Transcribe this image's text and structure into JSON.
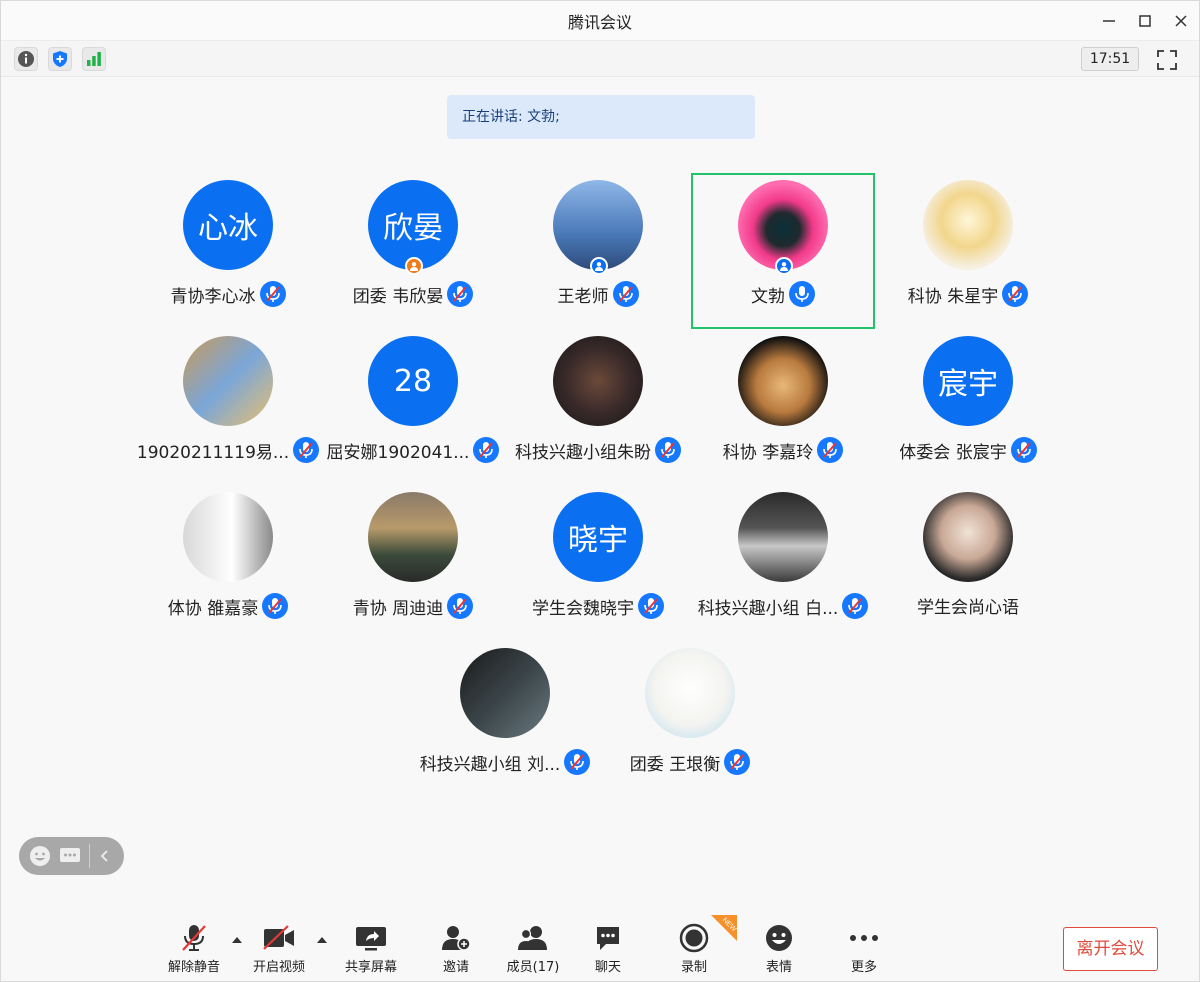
{
  "window": {
    "title": "腾讯会议"
  },
  "toolbar": {
    "time": "17:51"
  },
  "banner": {
    "text": "正在讲话: 文勃;"
  },
  "participants": [
    {
      "name": "青协李心冰",
      "avatar_text": "心冰",
      "avatar_type": "text",
      "badge": ""
    },
    {
      "name": "团委 韦欣晏",
      "avatar_text": "欣晏",
      "avatar_type": "text",
      "badge": "orange-person"
    },
    {
      "name": "王老师",
      "avatar_text": "",
      "avatar_type": "photo",
      "badge": "blue-person"
    },
    {
      "name": "文勃",
      "avatar_text": "",
      "avatar_type": "photo",
      "badge": "blue-person",
      "speaking": true
    },
    {
      "name": "科协 朱星宇",
      "avatar_text": "",
      "avatar_type": "photo",
      "badge": ""
    },
    {
      "name": "19020211119易...",
      "avatar_text": "",
      "avatar_type": "photo",
      "badge": ""
    },
    {
      "name": "屈安娜1902041...",
      "avatar_text": "28",
      "avatar_type": "text",
      "badge": ""
    },
    {
      "name": "科技兴趣小组朱盼",
      "avatar_text": "",
      "avatar_type": "photo",
      "badge": ""
    },
    {
      "name": "科协 李嘉玲",
      "avatar_text": "",
      "avatar_type": "photo",
      "badge": ""
    },
    {
      "name": "体委会 张宸宇",
      "avatar_text": "宸宇",
      "avatar_type": "text",
      "badge": ""
    },
    {
      "name": "体协 雒嘉豪",
      "avatar_text": "",
      "avatar_type": "photo",
      "badge": ""
    },
    {
      "name": "青协  周迪迪",
      "avatar_text": "",
      "avatar_type": "photo",
      "badge": ""
    },
    {
      "name": "学生会魏晓宇",
      "avatar_text": "晓宇",
      "avatar_type": "text",
      "badge": ""
    },
    {
      "name": "科技兴趣小组 白...",
      "avatar_text": "",
      "avatar_type": "photo",
      "badge": ""
    },
    {
      "name": "学生会尚心语",
      "avatar_text": "",
      "avatar_type": "photo",
      "badge": ""
    },
    {
      "name": "科技兴趣小组 刘...",
      "avatar_text": "",
      "avatar_type": "photo",
      "badge": ""
    },
    {
      "name": "团委 王垠衡",
      "avatar_text": "",
      "avatar_type": "photo",
      "badge": ""
    }
  ],
  "bottombar": {
    "unmute": "解除静音",
    "start_video": "开启视频",
    "share_screen": "共享屏幕",
    "invite": "邀请",
    "members": "成员(17)",
    "chat": "聊天",
    "record": "录制",
    "reactions": "表情",
    "more": "更多",
    "new_tag": "NEW",
    "leave": "离开会议"
  },
  "colors": {
    "accent": "#0a6ff0",
    "speaking_border": "#21c26a",
    "leave": "#e04a3d",
    "banner_bg": "#dce9fb"
  }
}
